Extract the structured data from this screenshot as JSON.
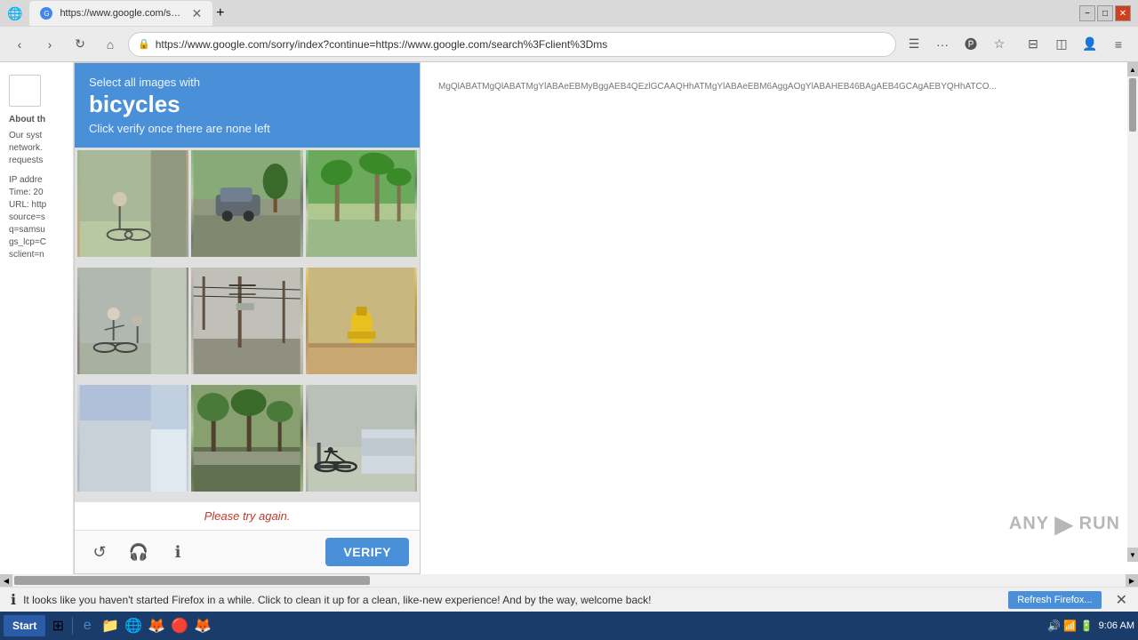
{
  "browser": {
    "title": "https://www.google.com/search?",
    "url": "https://www.google.com/sorry/index?continue=https://www.google.com/search%3Fclient%3Dms",
    "tab_label": "https://www.google.com/search?",
    "nav": {
      "back_disabled": false,
      "forward_disabled": false
    }
  },
  "captcha": {
    "header": {
      "select_text": "Select all images with",
      "main_label": "bicycles",
      "sub_text": "Click verify once there are none left"
    },
    "images": [
      {
        "id": 1,
        "has_bicycle": true,
        "description": "person on bicycle near wall"
      },
      {
        "id": 2,
        "has_bicycle": false,
        "description": "car on road with trees"
      },
      {
        "id": 3,
        "has_bicycle": false,
        "description": "palm trees road"
      },
      {
        "id": 4,
        "has_bicycle": true,
        "description": "person on bicycle near wall 2"
      },
      {
        "id": 5,
        "has_bicycle": false,
        "description": "street poles and wires"
      },
      {
        "id": 6,
        "has_bicycle": false,
        "description": "yellow fire hydrant"
      },
      {
        "id": 7,
        "has_bicycle": false,
        "description": "building corner"
      },
      {
        "id": 8,
        "has_bicycle": false,
        "description": "street with trees"
      },
      {
        "id": 9,
        "has_bicycle": true,
        "description": "bicycle parked near car"
      }
    ],
    "error_text": "Please try again.",
    "verify_button": "VERIFY",
    "footer_icons": {
      "refresh": "↺",
      "audio": "🎧",
      "info": "ℹ"
    }
  },
  "right_content": {
    "url_text": "MgQlABATMgQlABATMgYlABAeEBMyBggAEB4QEzlGCAAQHhATMgYlABAeEBM6AggAOgYlABAHEB46BAgAEB4GCAgAEBYQHhATCO..."
  },
  "sidebar": {
    "about_title": "About th",
    "about_text": "Our syst network. requests",
    "ip_text": "IP addre Time: 20 URL: http source=s q=samsu gs_lcp=C sclient=n"
  },
  "status_bar": {
    "message": "It looks like you haven't started Firefox in a while. Click to clean it up for a clean, like-new experience! And by the way, welcome back!",
    "refresh_label": "Refresh Firefox..."
  },
  "taskbar": {
    "start_label": "Start",
    "time": "9:06 AM",
    "icons": [
      "🌐",
      "📁",
      "⚙",
      "🦊",
      "🔴",
      "🦊"
    ]
  },
  "watermark": {
    "text": "ANY",
    "suffix": "RUN"
  },
  "colors": {
    "captcha_header_bg": "#4a90d9",
    "verify_btn_bg": "#4a90d9",
    "error_text": "#c0392b",
    "taskbar_bg": "#1a3c6b"
  }
}
